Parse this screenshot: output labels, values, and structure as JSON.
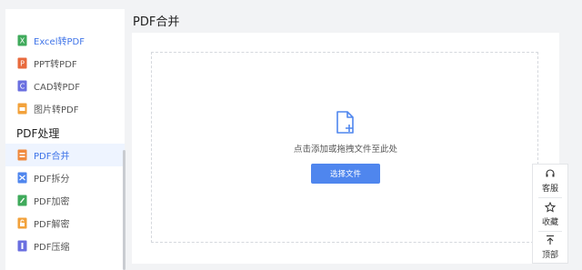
{
  "sidebar": {
    "convert_items": [
      {
        "label": "Excel转PDF",
        "icon": "excel-icon",
        "color": "#3faa5b",
        "active": true
      },
      {
        "label": "PPT转PDF",
        "icon": "ppt-icon",
        "color": "#e86a3d"
      },
      {
        "label": "CAD转PDF",
        "icon": "cad-icon",
        "color": "#6a6fe0"
      },
      {
        "label": "图片转PDF",
        "icon": "image-icon",
        "color": "#f2a13a"
      }
    ],
    "section_title": "PDF处理",
    "process_items": [
      {
        "label": "PDF合并",
        "icon": "merge-icon",
        "color": "#f08a3e",
        "active": true
      },
      {
        "label": "PDF拆分",
        "icon": "split-icon",
        "color": "#4f86ee"
      },
      {
        "label": "PDF加密",
        "icon": "encrypt-icon",
        "color": "#3faa5b"
      },
      {
        "label": "PDF解密",
        "icon": "decrypt-icon",
        "color": "#f2a13a"
      },
      {
        "label": "PDF压缩",
        "icon": "compress-icon",
        "color": "#6a6fe0"
      }
    ]
  },
  "main": {
    "title": "PDF合并",
    "drop_hint": "点击添加或拖拽文件至此处",
    "select_button": "选择文件",
    "accent": "#4f86ee"
  },
  "floating": {
    "service": "客服",
    "favorite": "收藏",
    "top": "顶部"
  }
}
